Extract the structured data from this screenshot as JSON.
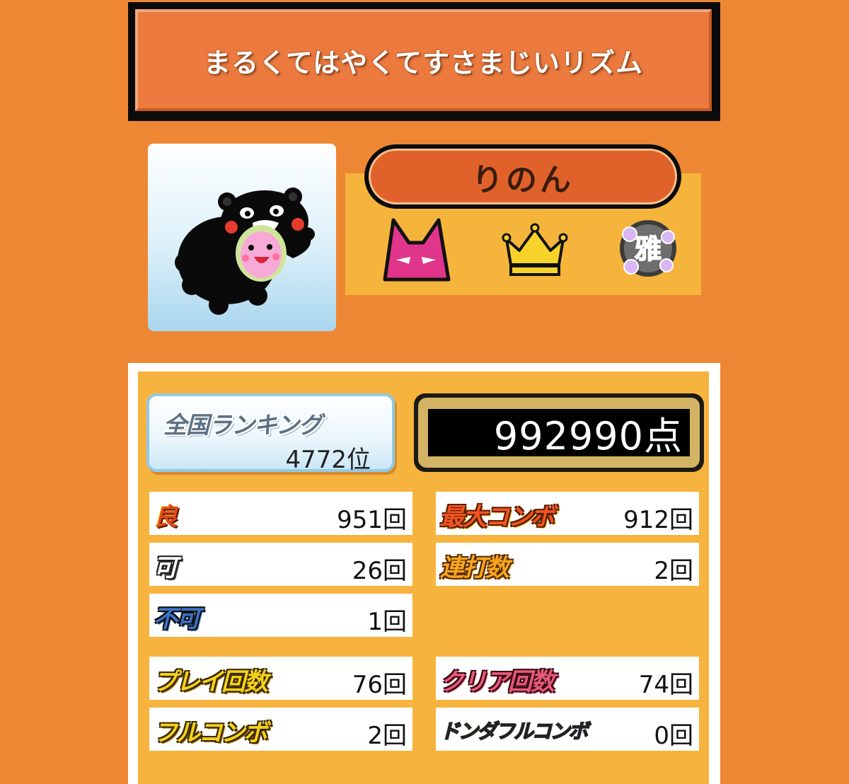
{
  "song": {
    "title": "まるくてはやくてすさまじいリズム"
  },
  "player": {
    "name": "りのん",
    "avatar_icon": "kumamon-don-icon",
    "badges": [
      "oni-difficulty-icon",
      "crown-icon",
      "miyabi-rank-icon"
    ]
  },
  "ranking": {
    "label": "全国ランキング",
    "value": "4772位"
  },
  "score": {
    "value": "992990点"
  },
  "stats": {
    "ryo": {
      "label": "良",
      "value": "951回"
    },
    "ka": {
      "label": "可",
      "value": "26回"
    },
    "fuka": {
      "label": "不可",
      "value": "1回"
    },
    "max_combo": {
      "label": "最大コンボ",
      "value": "912回"
    },
    "renda": {
      "label": "連打数",
      "value": "2回"
    },
    "play_count": {
      "label": "プレイ回数",
      "value": "76回"
    },
    "clear_count": {
      "label": "クリア回数",
      "value": "74回"
    },
    "full_combo": {
      "label": "フルコンボ",
      "value": "2回"
    },
    "donda_full_combo": {
      "label": "ドンダフルコンボ",
      "value": "0回"
    }
  },
  "colors": {
    "background": "#ee8734",
    "title_bar": "#ec7a3e",
    "panel": "#f6b33d",
    "name_pill": "#e0622a"
  }
}
